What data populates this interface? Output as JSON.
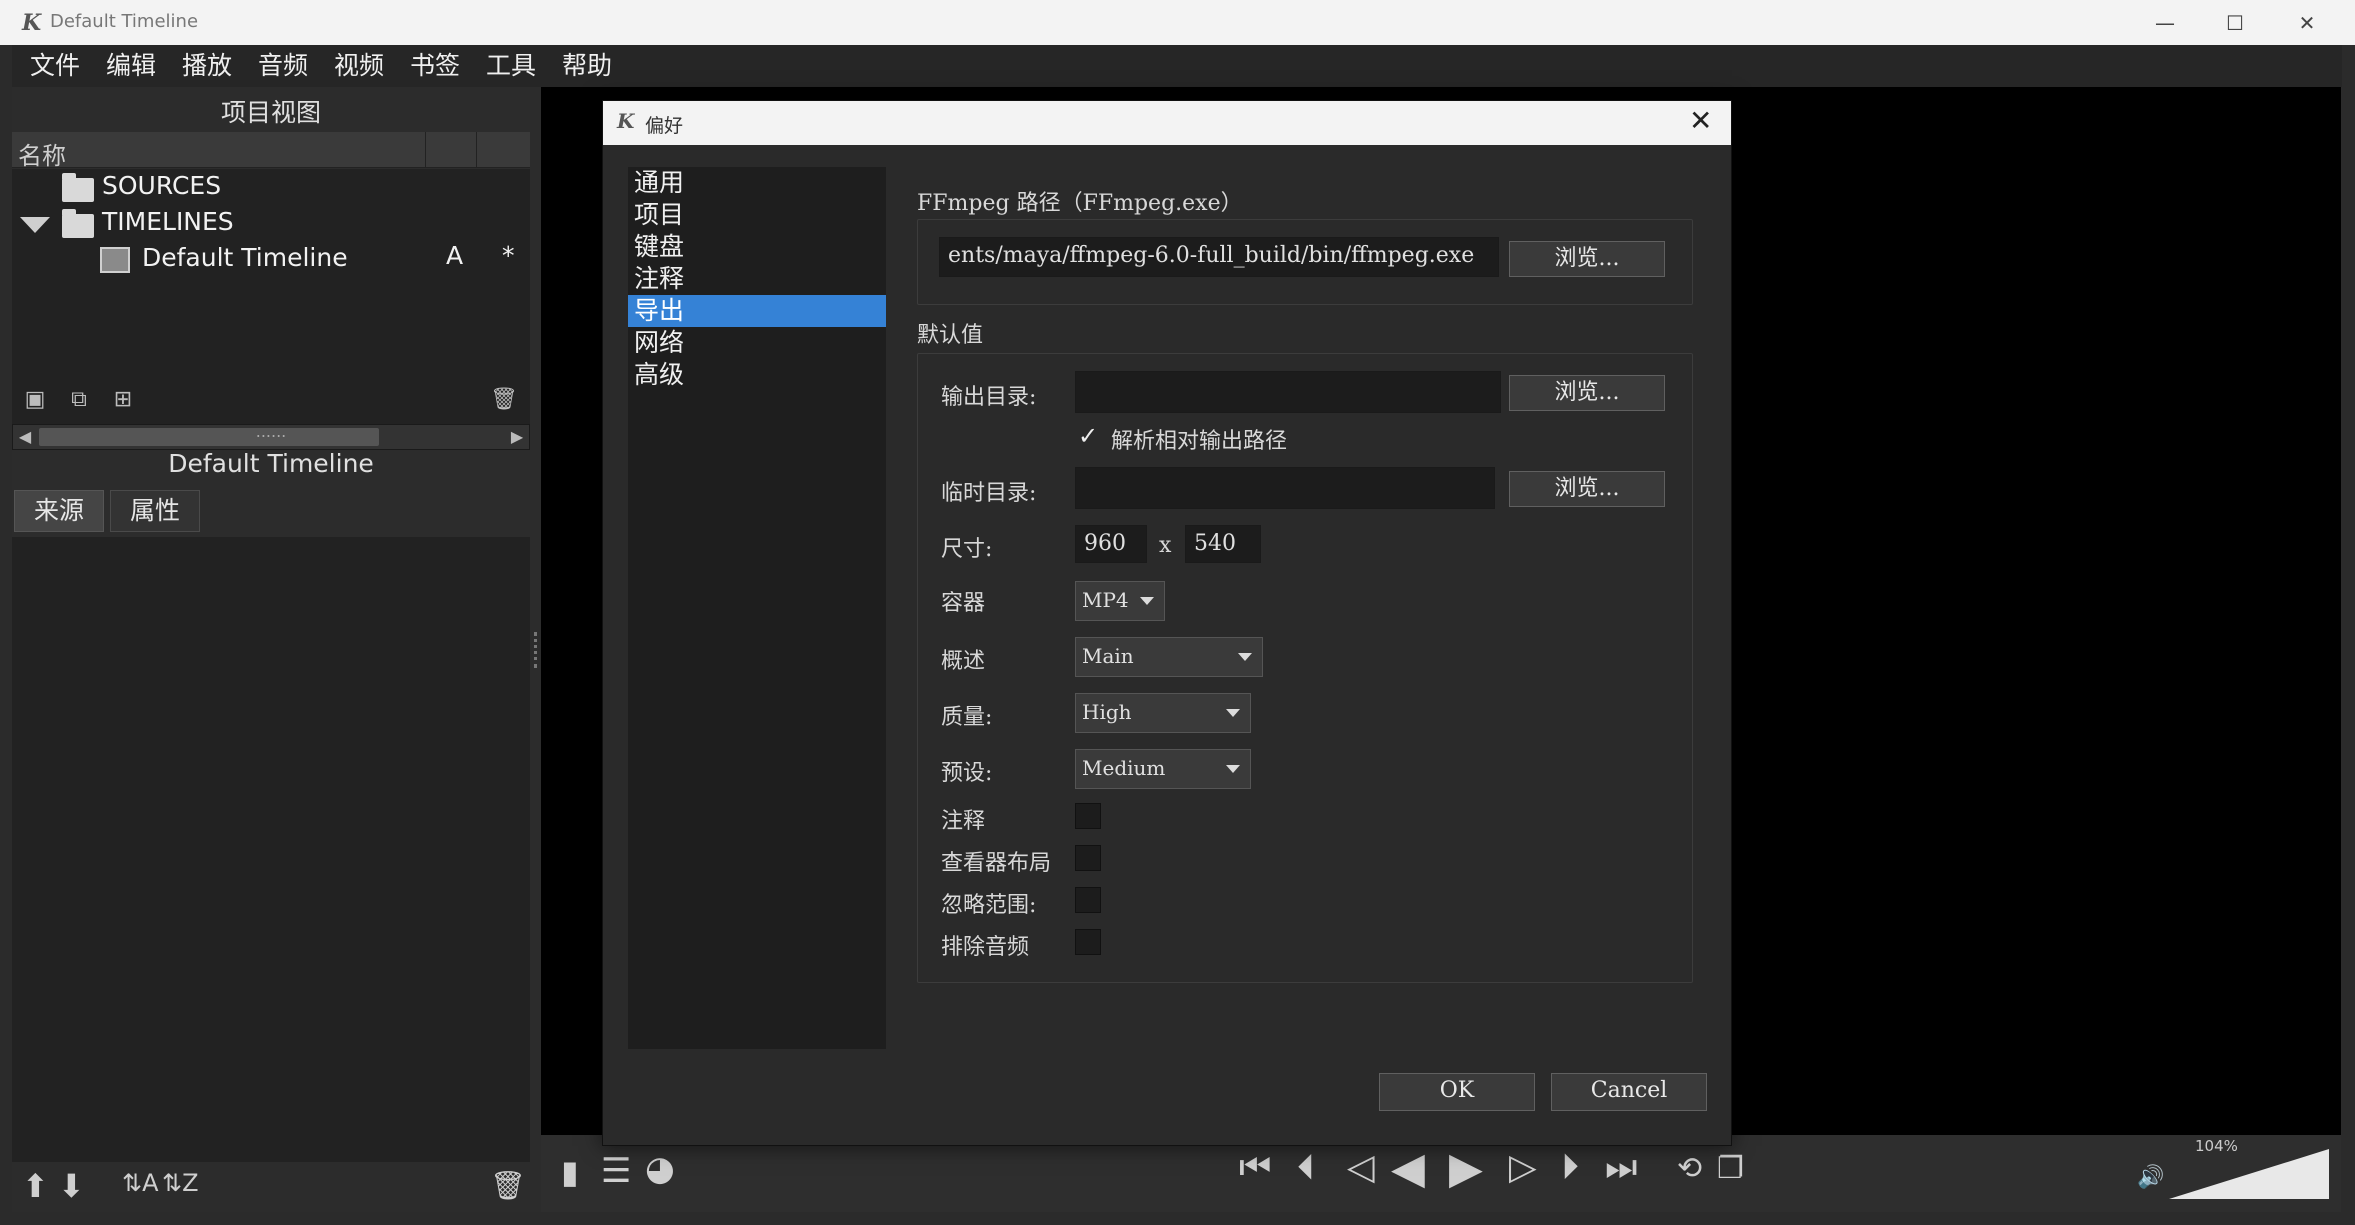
{
  "window": {
    "title": "Default Timeline",
    "controls": [
      "—",
      "☐",
      "✕"
    ]
  },
  "menubar": [
    "文件",
    "编辑",
    "播放",
    "音频",
    "视频",
    "书签",
    "工具",
    "帮助"
  ],
  "left_panel": {
    "title": "项目视图",
    "column_header": "名称",
    "tree": [
      {
        "label": "SOURCES",
        "type": "folder"
      },
      {
        "label": "TIMELINES",
        "type": "folder"
      },
      {
        "label": "Default Timeline",
        "type": "timeline",
        "col2": "A",
        "col3": "*"
      }
    ],
    "drag_handle": "......",
    "selected_name": "Default Timeline",
    "tabs": [
      "来源",
      "属性"
    ]
  },
  "viewer": {
    "zoom": "104%"
  },
  "dialog": {
    "title": "偏好",
    "categories": [
      "通用",
      "项目",
      "键盘",
      "注释",
      "导出",
      "网络",
      "高级"
    ],
    "selected_category": "导出",
    "ffmpeg": {
      "label": "FFmpeg 路径（FFmpeg.exe）",
      "value": "ents/maya/ffmpeg-6.0-full_build/bin/ffmpeg.exe",
      "browse": "浏览..."
    },
    "defaults": {
      "label": "默认值",
      "output_dir_label": "输出目录:",
      "output_dir_value": "",
      "browse1": "浏览...",
      "resolve_relative_label": "解析相对输出路径",
      "resolve_relative_checked": true,
      "temp_dir_label": "临时目录:",
      "temp_dir_value": "",
      "browse2": "浏览...",
      "size_label": "尺寸:",
      "width": "960",
      "x": "x",
      "height": "540",
      "container_label": "容器",
      "container_value": "MP4",
      "profile_label": "概述",
      "profile_value": "Main",
      "quality_label": "质量:",
      "quality_value": "High",
      "preset_label": "预设:",
      "preset_value": "Medium",
      "notes_label": "注释",
      "viewer_layout_label": "查看器布局",
      "ignore_range_label": "忽略范围:",
      "exclude_audio_label": "排除音频"
    },
    "ok": "OK",
    "cancel": "Cancel"
  }
}
